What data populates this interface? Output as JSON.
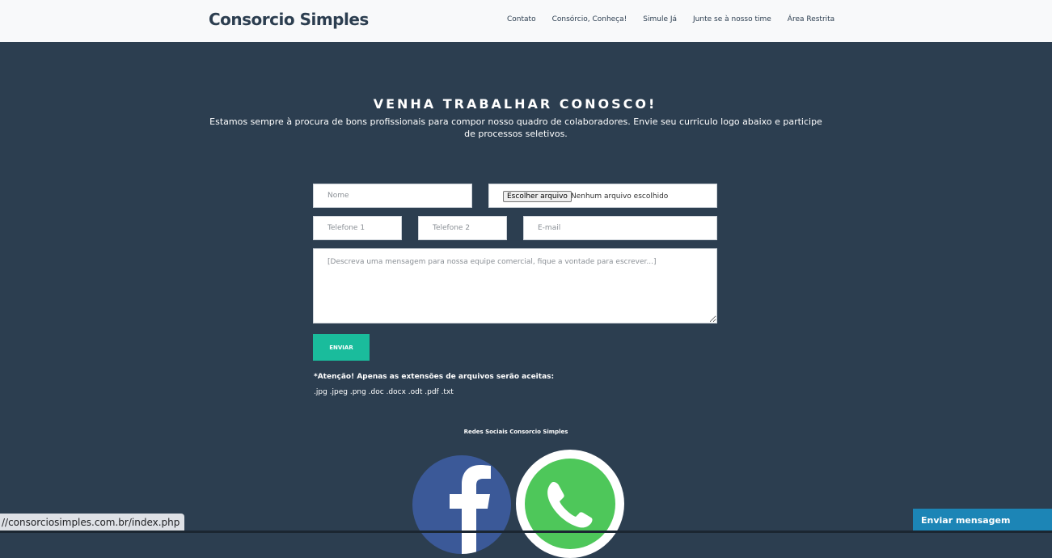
{
  "nav": {
    "brand": "Consorcio Simples",
    "links": [
      "Contato",
      "Consórcio, Conheça!",
      "Simule Já",
      "Junte se à nosso time",
      "Área Restrita"
    ]
  },
  "hero": {
    "title": "VENHA TRABALHAR CONOSCO!",
    "text": "Estamos sempre à procura de bons profissionais para compor nosso quadro de colaboradores. Envie seu curriculo logo abaixo e participe de processos seletivos."
  },
  "form": {
    "name_placeholder": "Nome",
    "file_button": "Escolher arquivo",
    "file_status": "Nenhum arquivo escolhido",
    "phone1_placeholder": "Telefone 1",
    "phone2_placeholder": "Telefone 2",
    "email_placeholder": "E-mail",
    "message_placeholder": "[Descreva uma mensagem para nossa equipe comercial, fique a vontade para escrever...]",
    "submit_label": "ENVIAR",
    "notice": "*Atenção! Apenas as extensões de arquivos serão aceitas:",
    "extensions": ".jpg .jpeg .png .doc .docx .odt .pdf .txt"
  },
  "social": {
    "title": "Redes Sociais Consorcio Simples",
    "icons": [
      "facebook-icon",
      "whatsapp-icon"
    ]
  },
  "browser": {
    "status_url": "//consorciosimples.com.br/index.php"
  },
  "chat": {
    "label": "Enviar mensagem"
  },
  "colors": {
    "background": "#2c3e50",
    "navbar": "#f8f9fa",
    "accent": "#1abc9c",
    "facebook": "#3b5998",
    "whatsapp": "#4ec75a",
    "chat": "#1c85b6"
  }
}
